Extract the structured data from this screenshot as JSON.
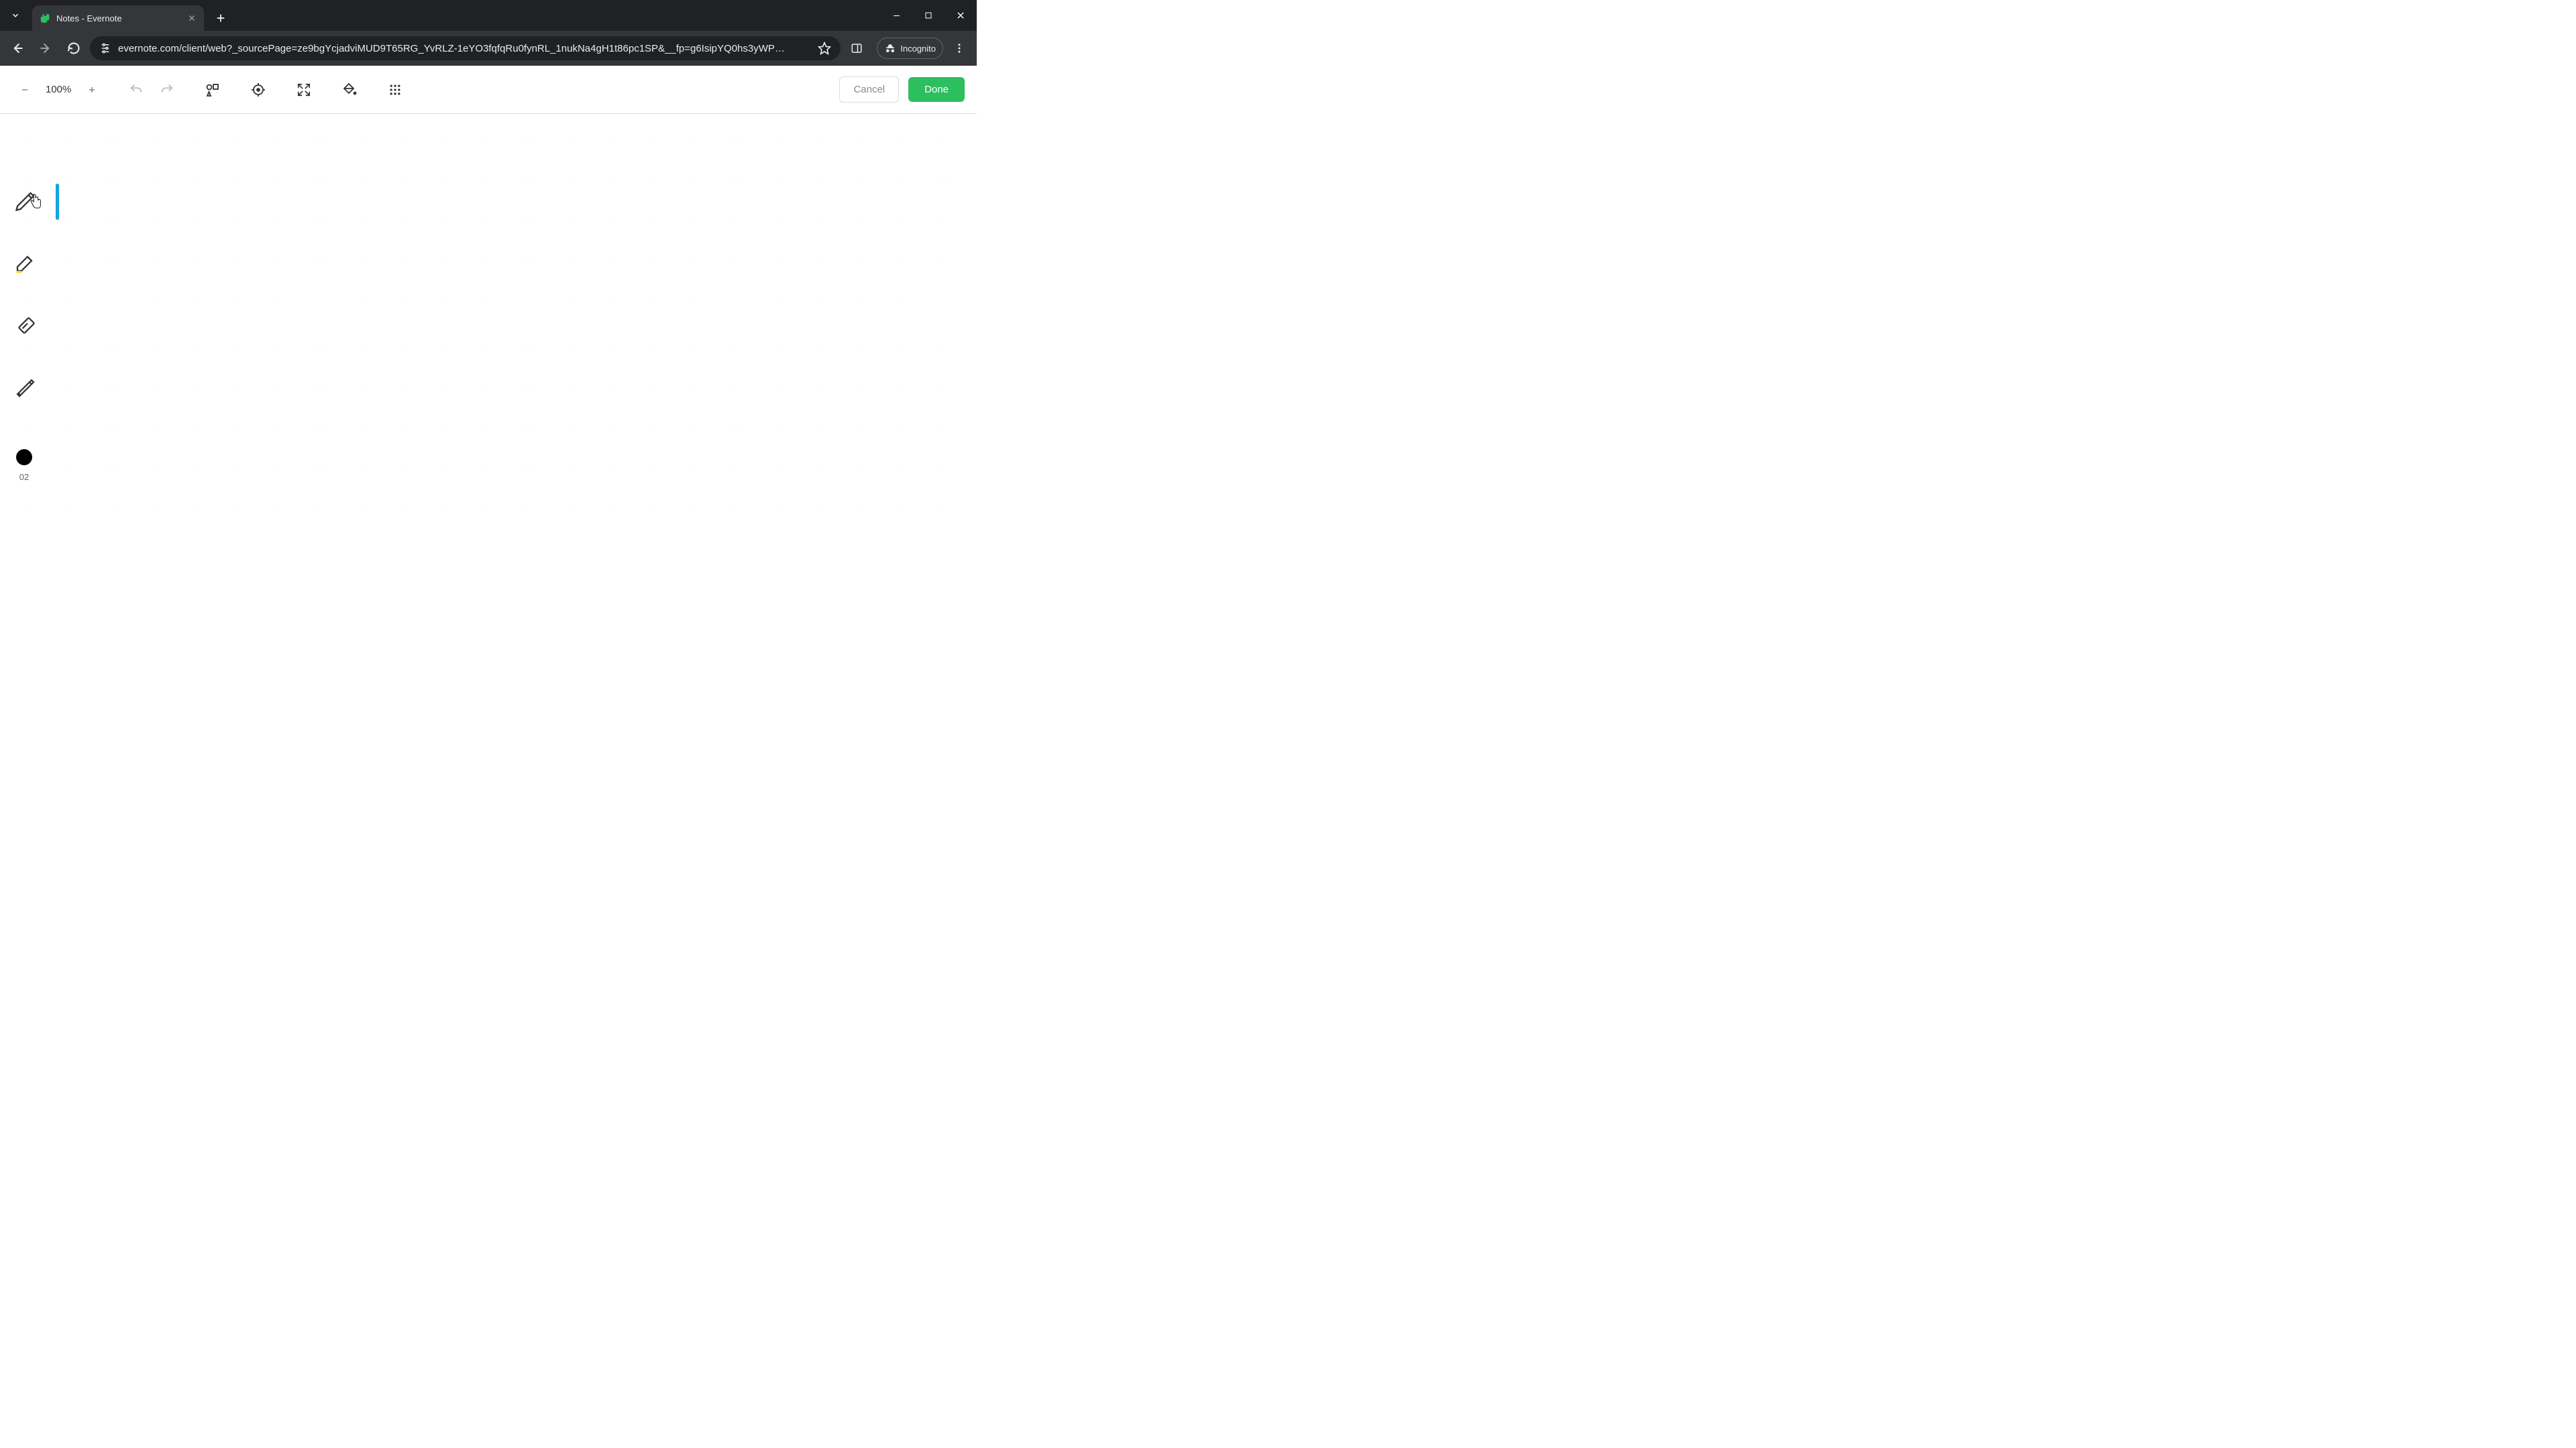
{
  "browser": {
    "tab_title": "Notes - Evernote",
    "url": "evernote.com/client/web?_sourcePage=ze9bgYcjadviMUD9T65RG_YvRLZ-1eYO3fqfqRu0fynRL_1nukNa4gH1t86pc1SP&__fp=g6IsipYQ0hs3yWP…",
    "incognito_label": "Incognito"
  },
  "toolbar": {
    "zoom_level": "100%",
    "cancel_label": "Cancel",
    "done_label": "Done"
  },
  "sidebar": {
    "color_label": "02"
  }
}
